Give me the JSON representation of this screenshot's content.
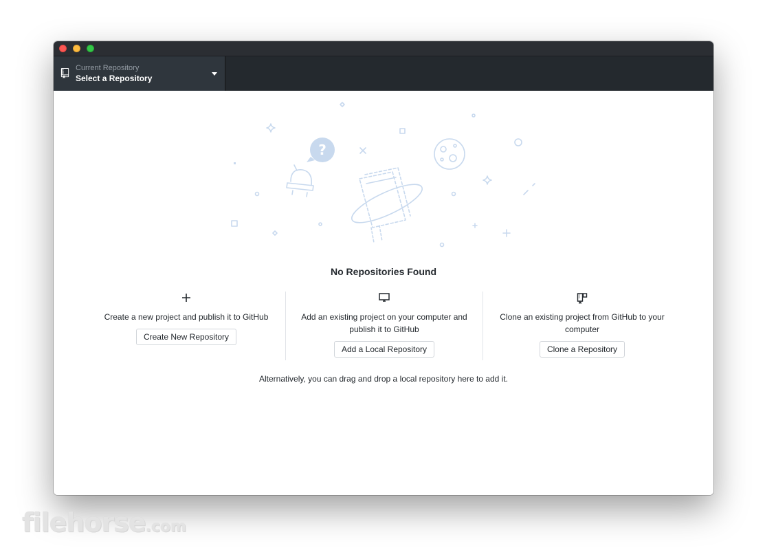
{
  "window": {
    "traffic_lights": [
      "close",
      "minimize",
      "maximize"
    ],
    "colors": {
      "close": "#fc5753",
      "minimize": "#fdbc40",
      "maximize": "#33c748",
      "toolbar_bg": "#24292e"
    }
  },
  "toolbar": {
    "repo_selector": {
      "icon": "repo-icon",
      "description": "Current Repository",
      "title": "Select a Repository",
      "caret_icon": "triangle-down-icon"
    }
  },
  "blank_slate": {
    "title": "No Repositories Found",
    "actions": [
      {
        "icon": "plus-icon",
        "description": "Create a new project and publish it to GitHub",
        "button_label": "Create New Repository"
      },
      {
        "icon": "desktop-icon",
        "description": "Add an existing project on your computer and publish it to GitHub",
        "button_label": "Add a Local Repository"
      },
      {
        "icon": "repo-clone-icon",
        "description": "Clone an existing project from GitHub to your computer",
        "button_label": "Clone a Repository"
      }
    ],
    "drag_hint": "Alternatively, you can drag and drop a local repository here to add it."
  },
  "watermark": {
    "main": "filehorse",
    "suffix": ".com"
  }
}
